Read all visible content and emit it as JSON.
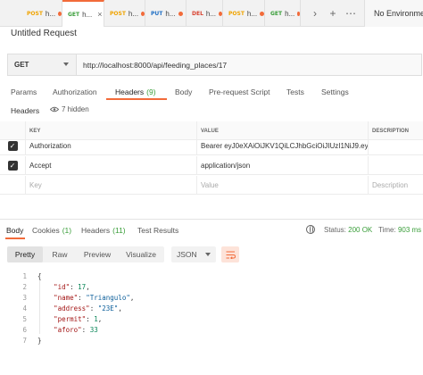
{
  "tabs": [
    {
      "method": "POST",
      "name": "h...",
      "method_color": "#f0a400",
      "active": false
    },
    {
      "method": "GET",
      "name": "h...",
      "method_color": "#3a9e3a",
      "active": true
    },
    {
      "method": "POST",
      "name": "h...",
      "method_color": "#f0a400",
      "active": false
    },
    {
      "method": "PUT",
      "name": "h...",
      "method_color": "#1f6fc4",
      "active": false
    },
    {
      "method": "DEL",
      "name": "h...",
      "method_color": "#d8412f",
      "active": false
    },
    {
      "method": "POST",
      "name": "h...",
      "method_color": "#f0a400",
      "active": false
    },
    {
      "method": "GET",
      "name": "h...",
      "method_color": "#3a9e3a",
      "active": false
    }
  ],
  "toolbar": {
    "more_icon": "chevron-right-icon",
    "add_icon": "plus-icon",
    "menu_icon": "ellipsis-icon",
    "close_glyph": "×",
    "environment": "No Environment"
  },
  "request": {
    "title": "Untitled Request",
    "method": "GET",
    "url": "http://localhost:8000/api/feeding_places/17"
  },
  "request_tabs": [
    {
      "label": "Params",
      "count": ""
    },
    {
      "label": "Authorization",
      "count": ""
    },
    {
      "label": "Headers",
      "count": "(9)"
    },
    {
      "label": "Body",
      "count": ""
    },
    {
      "label": "Pre-request Script",
      "count": ""
    },
    {
      "label": "Tests",
      "count": ""
    },
    {
      "label": "Settings",
      "count": ""
    }
  ],
  "headers_section": {
    "label": "Headers",
    "hidden_toggle": "7 hidden"
  },
  "headers_table": {
    "columns": {
      "key": "KEY",
      "value": "VALUE",
      "description": "DESCRIPTION"
    },
    "rows": [
      {
        "checked": true,
        "key": "Authorization",
        "value": "Bearer eyJ0eXAiOiJKV1QiLCJhbGciOiJIUzI1NiJ9.ey..."
      },
      {
        "checked": true,
        "key": "Accept",
        "value": "application/json"
      }
    ],
    "placeholder": {
      "key": "Key",
      "value": "Value",
      "description": "Description"
    }
  },
  "response_tabs": [
    {
      "label": "Body",
      "count": ""
    },
    {
      "label": "Cookies",
      "count": "(1)"
    },
    {
      "label": "Headers",
      "count": "(11)"
    },
    {
      "label": "Test Results",
      "count": ""
    }
  ],
  "status": {
    "status_label": "Status:",
    "status_value": "200 OK",
    "time_label": "Time:",
    "time_value": "903 ms"
  },
  "view_modes": [
    "Pretty",
    "Raw",
    "Preview",
    "Visualize"
  ],
  "format": "JSON",
  "json_lines": [
    {
      "n": "1",
      "text": "{"
    },
    {
      "n": "2",
      "key": "\"id\"",
      "value": "17",
      "type": "num",
      "comma": true
    },
    {
      "n": "3",
      "key": "\"name\"",
      "value": "\"Triangulo\"",
      "type": "str",
      "comma": true
    },
    {
      "n": "4",
      "key": "\"address\"",
      "value": "\"23E\"",
      "type": "str",
      "comma": true
    },
    {
      "n": "5",
      "key": "\"permit\"",
      "value": "1",
      "type": "num",
      "comma": true
    },
    {
      "n": "6",
      "key": "\"aforo\"",
      "value": "33",
      "type": "num",
      "comma": false
    },
    {
      "n": "7",
      "text": "}"
    }
  ]
}
